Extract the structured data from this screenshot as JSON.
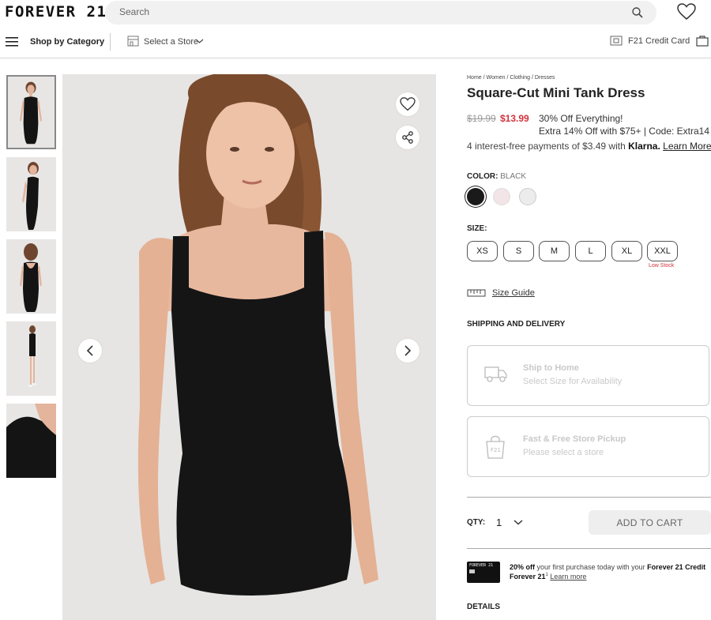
{
  "header": {
    "logo": "FOREVER 21",
    "search_placeholder": "Search"
  },
  "subnav": {
    "shop_by_category": "Shop by Category",
    "select_store": "Select a Store",
    "credit_card": "F21 Credit Card"
  },
  "product": {
    "breadcrumb": "Home / Women / Clothing / Dresses",
    "title": "Square-Cut Mini Tank Dress",
    "price_original": "$19.99",
    "price_sale": "$13.99",
    "promo_line1": "30% Off Everything!",
    "promo_line2": "Extra 14% Off with $75+ | Code: Extra14",
    "klarna_prefix": "4 interest-free payments of $3.49 with ",
    "klarna_brand": "Klarna.",
    "klarna_link": "Learn More",
    "color_label": "COLOR:",
    "color_value": "BLACK",
    "colors": [
      "#1a1a1a",
      "#f3e4e8",
      "#ececec"
    ],
    "size_label": "SIZE:",
    "sizes": [
      "XS",
      "S",
      "M",
      "L",
      "XL",
      "XXL"
    ],
    "low_stock": "Low Stock",
    "size_guide": "Size Guide",
    "shipping_label": "SHIPPING AND DELIVERY",
    "ship_home_title": "Ship to Home",
    "ship_home_sub": "Select Size for Availability",
    "pickup_title": "Fast & Free Store Pickup",
    "pickup_sub": "Please select a store",
    "qty_label": "QTY:",
    "qty_value": "1",
    "add_to_cart": "ADD TO CART",
    "offer_pct": "20% off",
    "offer_text": " your first purchase today with your ",
    "offer_card": "Forever 21 Credit",
    "offer_line2": "Forever 21",
    "offer_sup": "1",
    "offer_link": "Learn more",
    "card_text": "FOREVER 21",
    "details_label": "DETAILS"
  },
  "colors": {
    "sale_red": "#d1323c",
    "dress_black": "#151515"
  }
}
